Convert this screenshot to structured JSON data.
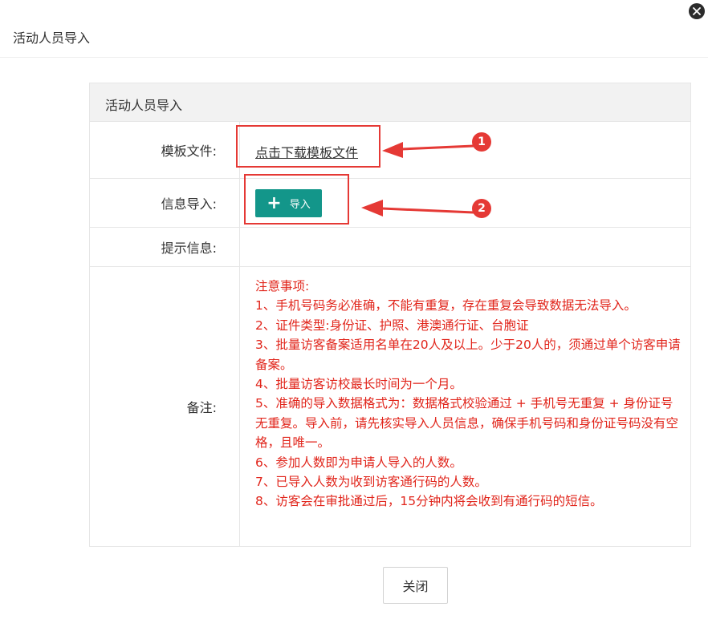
{
  "dialog": {
    "title": "活动人员导入",
    "close_icon": "close-icon"
  },
  "form": {
    "section_title": "活动人员导入",
    "rows": {
      "template": {
        "label": "模板文件:",
        "link_text": "点击下载模板文件"
      },
      "import": {
        "label": "信息导入:",
        "button_label": "导入",
        "button_icon": "plus-icon"
      },
      "tip": {
        "label": "提示信息:",
        "value": ""
      },
      "remark": {
        "label": "备注:",
        "lines": [
          "注意事项:",
          "1、手机号码务必准确，不能有重复，存在重复会导致数据无法导入。",
          "2、证件类型:身份证、护照、港澳通行证、台胞证",
          "3、批量访客备案适用名单在20人及以上。少于20人的，须通过单个访客申请备案。",
          "4、批量访客访校最长时间为一个月。",
          "5、准确的导入数据格式为：数据格式校验通过 + 手机号无重复 + 身份证号无重复。导入前，请先核实导入人员信息，确保手机号码和身份证号码没有空格，且唯一。",
          "6、参加人数即为申请人导入的人数。",
          "7、已导入人数为收到访客通行码的人数。",
          "8、访客会在审批通过后，15分钟内将会收到有通行码的短信。"
        ]
      }
    }
  },
  "annotations": [
    {
      "number": "1"
    },
    {
      "number": "2"
    }
  ],
  "footer": {
    "close_label": "关闭"
  },
  "colors": {
    "accent": "#13968a",
    "remark_text": "#e1251b",
    "annotation": "#e53935"
  }
}
